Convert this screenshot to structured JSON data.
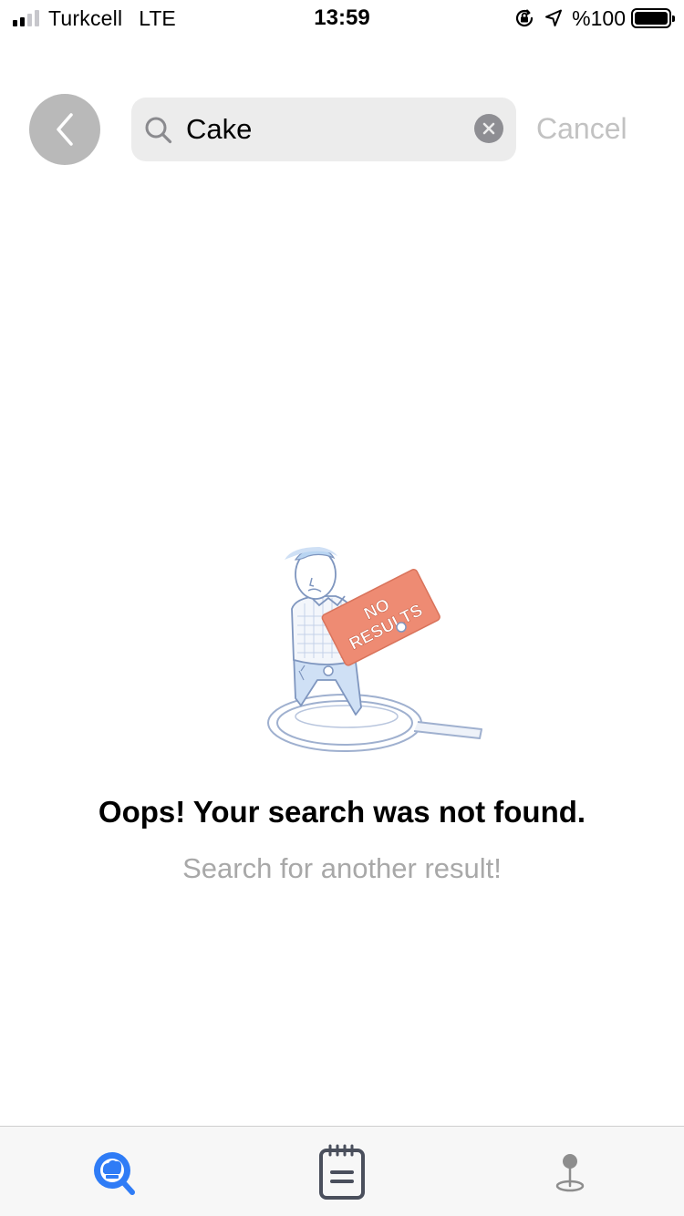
{
  "status_bar": {
    "carrier": "Turkcell",
    "network": "LTE",
    "time": "13:59",
    "battery": "%100",
    "signal_bars": 2,
    "signal_total": 4,
    "icons": [
      "orientation-lock-icon",
      "location-arrow-icon",
      "battery-icon"
    ]
  },
  "header": {
    "back_icon": "chevron-left-icon",
    "search": {
      "value": "Cake",
      "icon": "search-icon",
      "clear_icon": "clear-circle-icon"
    },
    "cancel_label": "Cancel"
  },
  "empty_state": {
    "illustration": "no-results-illustration",
    "sign_text_line1": "NO",
    "sign_text_line2": "RESULTS",
    "title": "Oops! Your search was not found.",
    "subtitle": "Search for another result!"
  },
  "tab_bar": {
    "tabs": [
      {
        "icon": "chef-search-icon",
        "active": true
      },
      {
        "icon": "notepad-icon",
        "active": false
      },
      {
        "icon": "location-pin-icon",
        "active": false
      }
    ]
  },
  "colors": {
    "accent": "#2f7cf6",
    "sign": "#ee8b73",
    "illustration_line": "#8fa4c8",
    "inactive_icon": "#8d8d8d"
  }
}
